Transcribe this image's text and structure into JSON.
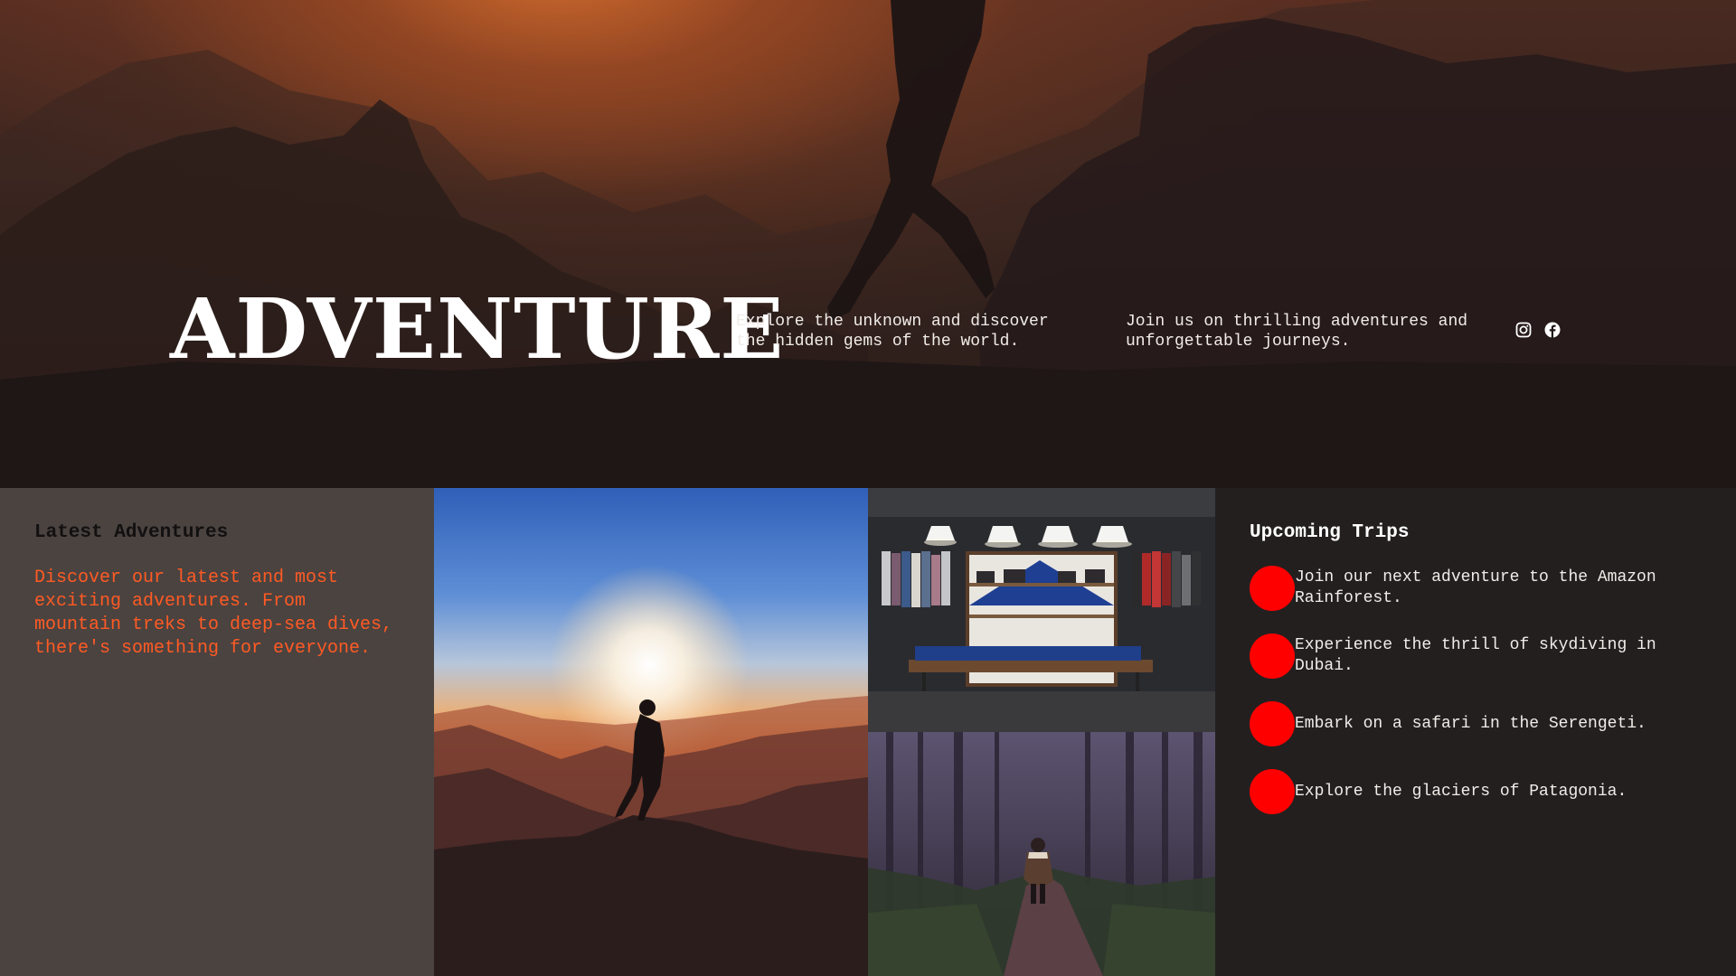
{
  "hero": {
    "title": "ADVENTURE",
    "text_one": "Explore the unknown and discover the hidden gems of the world.",
    "text_two": "Join us on thrilling adventures and unforgettable journeys.",
    "social": [
      {
        "icon": "instagram-icon"
      },
      {
        "icon": "facebook-icon"
      }
    ]
  },
  "latest": {
    "heading": "Latest Adventures",
    "body": "Discover our latest and most exciting adventures. From mountain treks to deep-sea dives, there's something for everyone."
  },
  "upcoming": {
    "heading": "Upcoming Trips",
    "trips": [
      "Join our next adventure to the Amazon Rainforest.",
      "Experience the thrill of skydiving in Dubai.",
      "Embark on a safari in the Serengeti.",
      "Explore the glaciers of Patagonia."
    ]
  },
  "colors": {
    "accent_text": "#ff5a24",
    "trip_dot": "#ff0000",
    "left_panel_bg": "#4a4340",
    "right_panel_bg": "#231f1f"
  }
}
